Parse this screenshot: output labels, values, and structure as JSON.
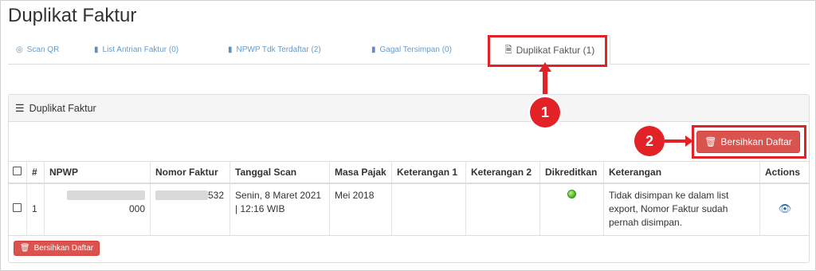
{
  "page": {
    "title": "Duplikat Faktur"
  },
  "tabs": [
    {
      "icon": "qr-icon",
      "label": "Scan QR"
    },
    {
      "icon": "file-icon",
      "label": "List Antrian Faktur (0)"
    },
    {
      "icon": "file-icon",
      "label": "NPWP Tdk Terdaftar (2)"
    },
    {
      "icon": "file-icon",
      "label": "Gagal Tersimpan (0)"
    },
    {
      "icon": "file-search-icon",
      "label": "Duplikat Faktur (1)",
      "active": true
    }
  ],
  "panel": {
    "icon": "list-icon",
    "title": "Duplikat Faktur"
  },
  "actions": {
    "clear_label": "Bersihkan Daftar",
    "clear_icon": "trash-icon"
  },
  "table": {
    "columns": [
      "",
      "#",
      "NPWP",
      "Nomor Faktur",
      "Tanggal Scan",
      "Masa Pajak",
      "Keterangan 1",
      "Keterangan 2",
      "Dikreditkan",
      "Keterangan",
      "Actions"
    ],
    "rows": [
      {
        "no": "1",
        "npwp_suffix": "000",
        "nomor_faktur_suffix": "532",
        "tanggal_scan": "Senin, 8 Maret 2021 | 12:16 WIB",
        "masa_pajak": "Mei 2018",
        "keterangan1": "",
        "keterangan2": "",
        "dikreditkan": "green-dot-icon",
        "keterangan": "Tidak disimpan ke dalam list export, Nomor Faktur sudah pernah disimpan.",
        "action_icon": "eye-icon"
      }
    ]
  },
  "annotations": {
    "marker1": "1",
    "marker2": "2",
    "color": "#e32228"
  }
}
